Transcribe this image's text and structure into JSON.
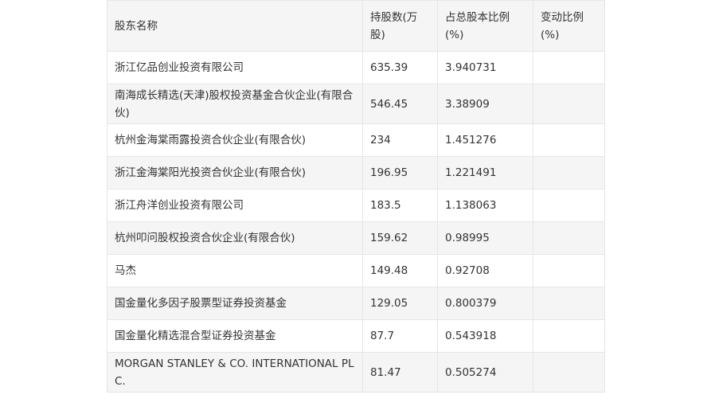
{
  "table": {
    "headers": [
      "股东名称",
      "持股数(万股)",
      "占总股本比例(%)",
      "变动比例(%)"
    ],
    "rows": [
      [
        "浙江亿品创业投资有限公司",
        "635.39",
        "3.940731",
        ""
      ],
      [
        "南海成长精选(天津)股权投资基金合伙企业(有限合伙)",
        "546.45",
        "3.38909",
        ""
      ],
      [
        "杭州金海棠雨露投资合伙企业(有限合伙)",
        "234",
        "1.451276",
        ""
      ],
      [
        "浙江金海棠阳光投资合伙企业(有限合伙)",
        "196.95",
        "1.221491",
        ""
      ],
      [
        "浙江舟洋创业投资有限公司",
        "183.5",
        "1.138063",
        ""
      ],
      [
        "杭州叩问股权投资合伙企业(有限合伙)",
        "159.62",
        "0.98995",
        ""
      ],
      [
        "马杰",
        "149.48",
        "0.92708",
        ""
      ],
      [
        "国金量化多因子股票型证券投资基金",
        "129.05",
        "0.800379",
        ""
      ],
      [
        "国金量化精选混合型证券投资基金",
        "87.7",
        "0.543918",
        ""
      ],
      [
        "MORGAN STANLEY & CO. INTERNATIONAL PLC.",
        "81.47",
        "0.505274",
        ""
      ]
    ]
  }
}
